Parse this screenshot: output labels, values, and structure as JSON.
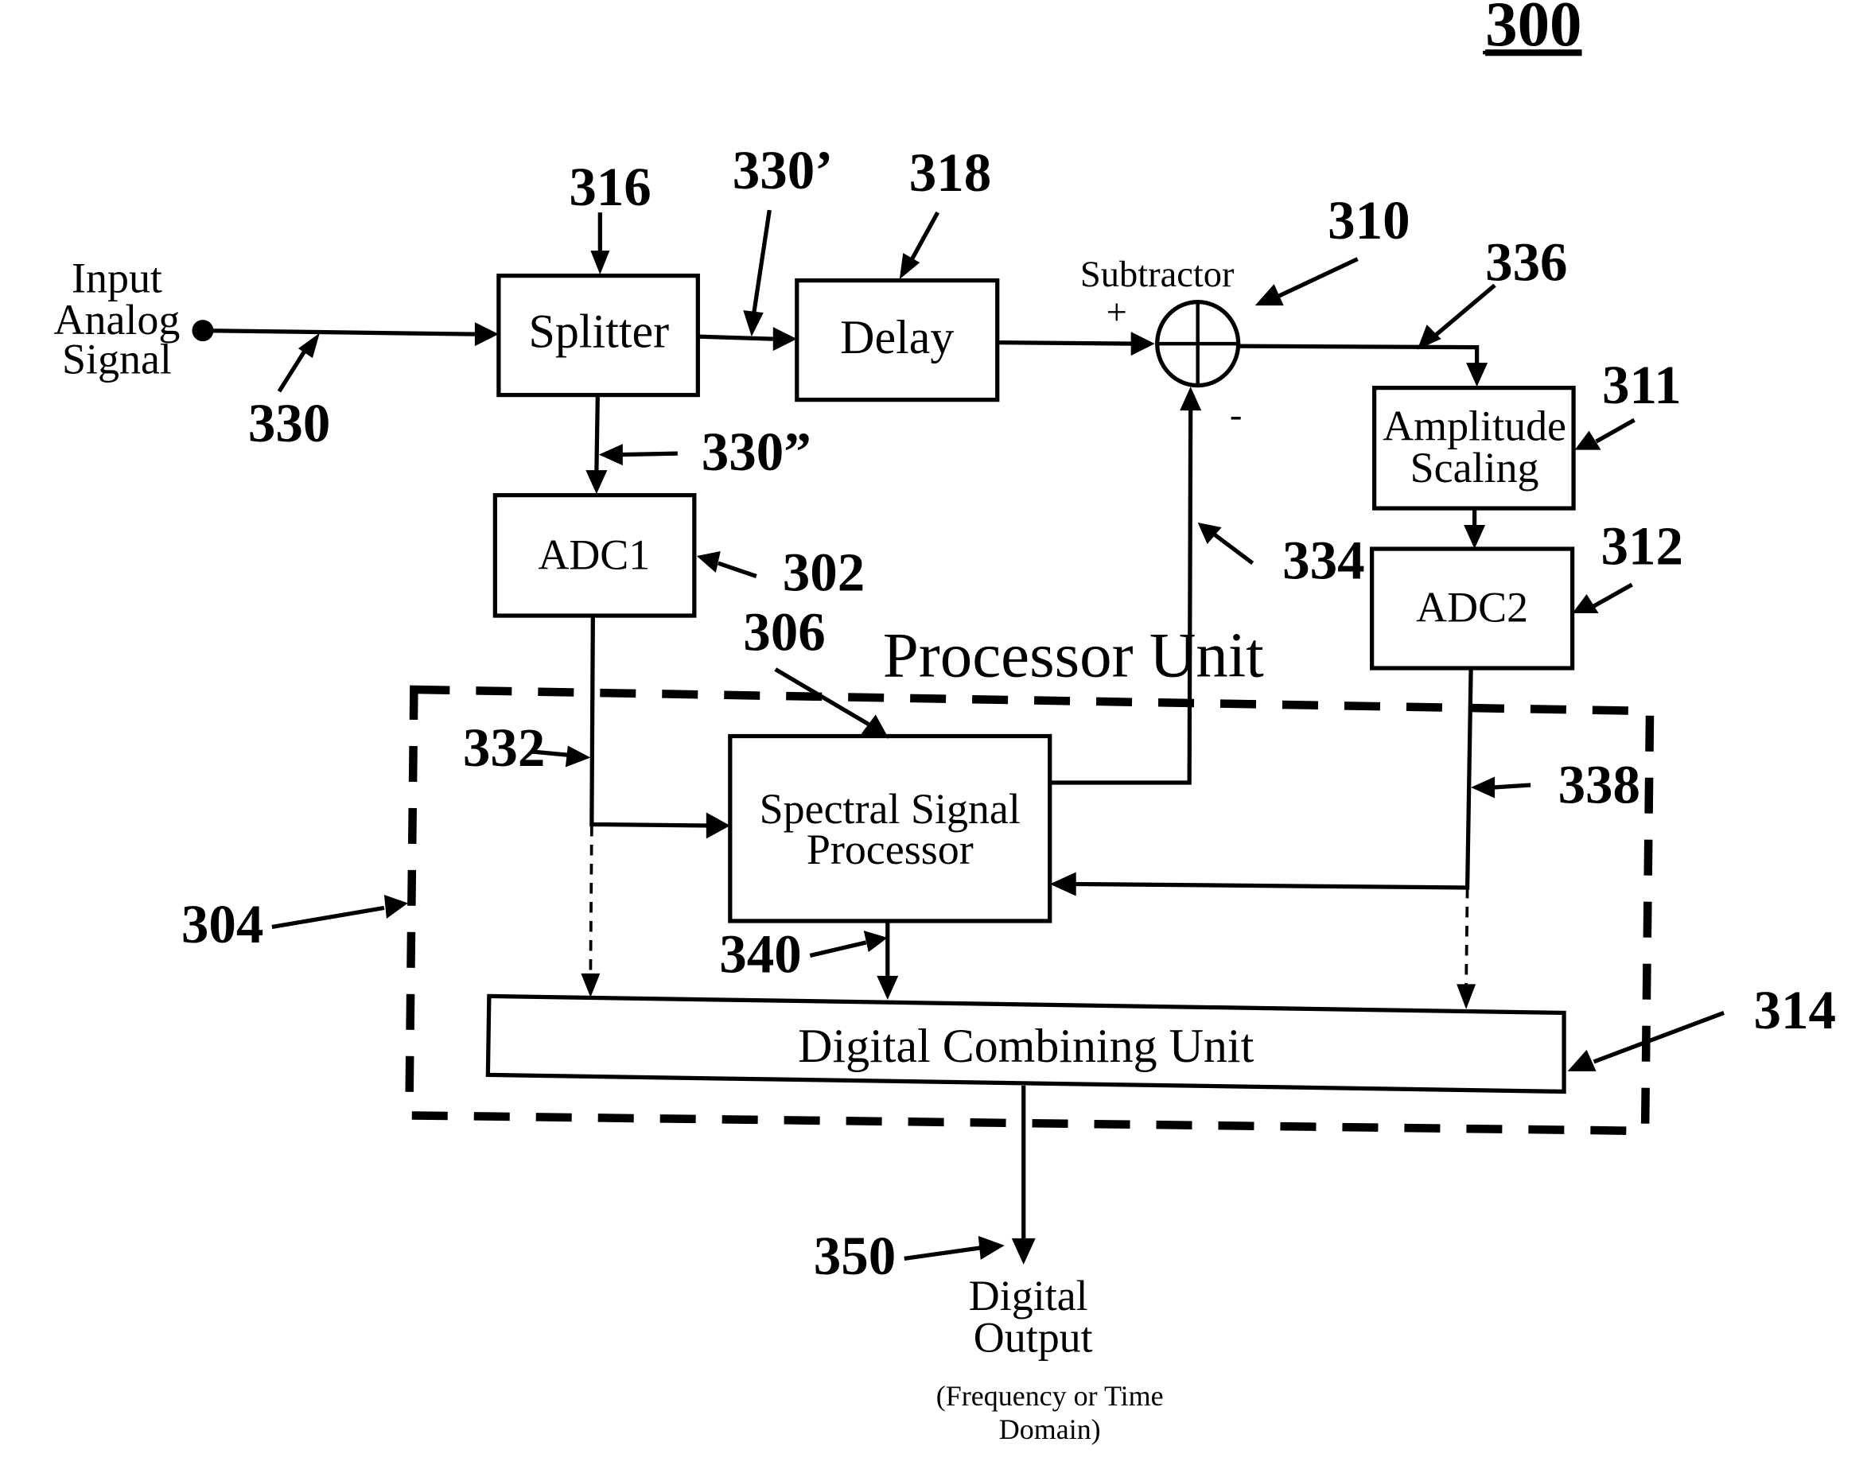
{
  "figure": {
    "number": "300"
  },
  "input": {
    "label_lines": [
      "Input",
      "Analog",
      "Signal"
    ],
    "ref": "330"
  },
  "blocks": {
    "splitter": {
      "label": "Splitter",
      "ref": "316"
    },
    "delay": {
      "label": "Delay",
      "ref": "318"
    },
    "subtractor": {
      "label": "Subtractor",
      "ref": "310",
      "plus_sign": "+",
      "minus_sign": "-"
    },
    "amplitude_scaling": {
      "label_lines": [
        "Amplitude",
        "Scaling"
      ],
      "ref": "311"
    },
    "adc1": {
      "label": "ADC1",
      "ref": "302"
    },
    "adc2": {
      "label": "ADC2",
      "ref": "312"
    },
    "spectral_signal_processor": {
      "label_lines": [
        "Spectral Signal",
        "Processor"
      ],
      "ref": "306"
    },
    "digital_combining_unit": {
      "label": "Digital Combining Unit",
      "ref": "314"
    },
    "processor_unit": {
      "label": "Processor Unit",
      "ref": "304"
    }
  },
  "signals": {
    "splitter_to_delay": "330’",
    "splitter_to_adc1": "330”",
    "adc1_out": "332",
    "ssp_to_subtractor": "334",
    "subtractor_out": "336",
    "adc2_out": "338",
    "ssp_to_combiner": "340",
    "output": "350"
  },
  "output": {
    "label_lines": [
      "Digital",
      "Output"
    ],
    "note_lines": [
      "(Frequency or Time",
      "Domain)"
    ]
  }
}
